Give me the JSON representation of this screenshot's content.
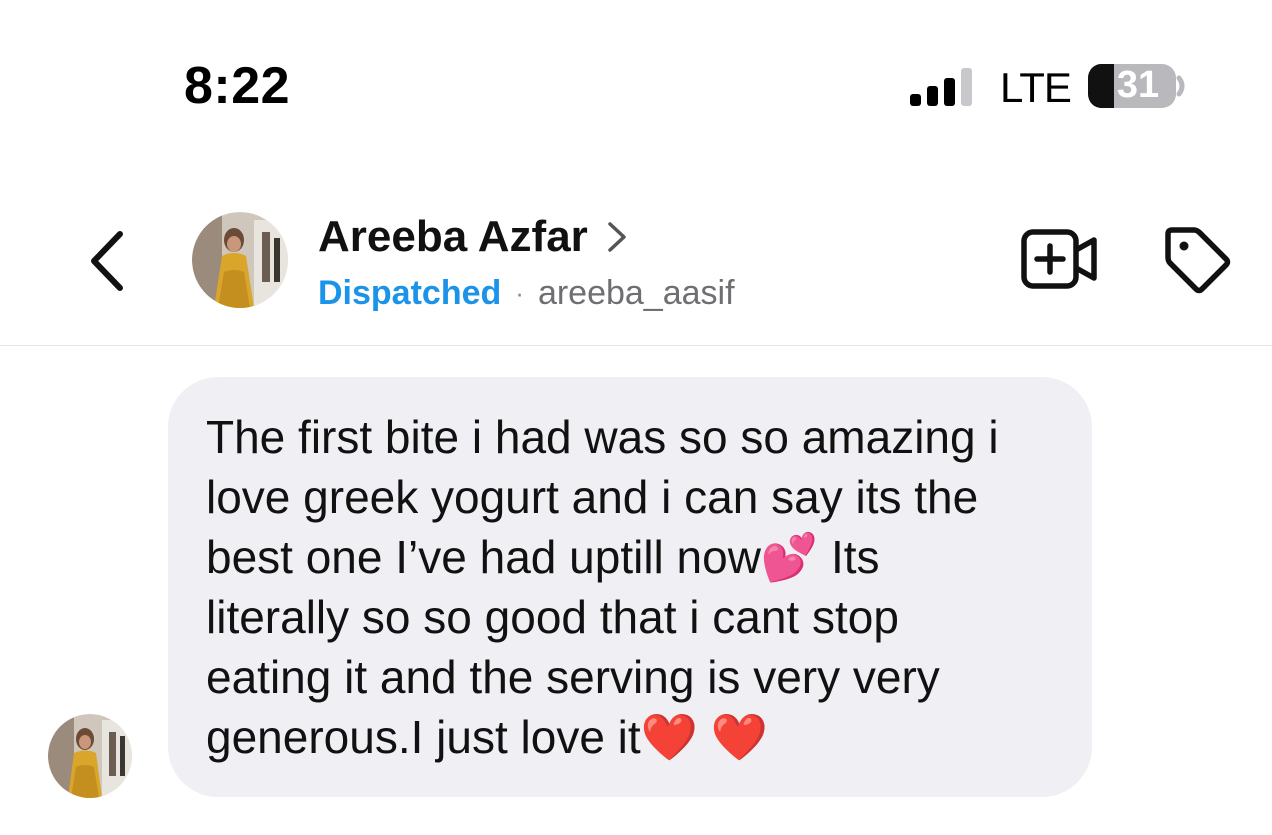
{
  "status_bar": {
    "time": "8:22",
    "network": "LTE",
    "battery": "31"
  },
  "header": {
    "contact_name": "Areeba Azfar",
    "status": "Dispatched",
    "separator": "·",
    "username": "areeba_aasif"
  },
  "icons": {
    "back": "chevron-left-icon",
    "video": "video-call-plus-icon",
    "tag": "tag-icon",
    "signal": "cellular-signal-icon",
    "battery": "battery-icon"
  },
  "colors": {
    "status_blue": "#1a93e8",
    "bubble_bg": "#efeff4",
    "divider": "#e6e6e6"
  },
  "message": {
    "text": "The first bite i had was so so amazing i\nlove greek yogurt and i can say its the\nbest one I’ve had uptill now💕 Its\nliterally so so good that i cant stop\neating it and the serving is very very\ngenerous.I just love it❤️ ❤️"
  }
}
